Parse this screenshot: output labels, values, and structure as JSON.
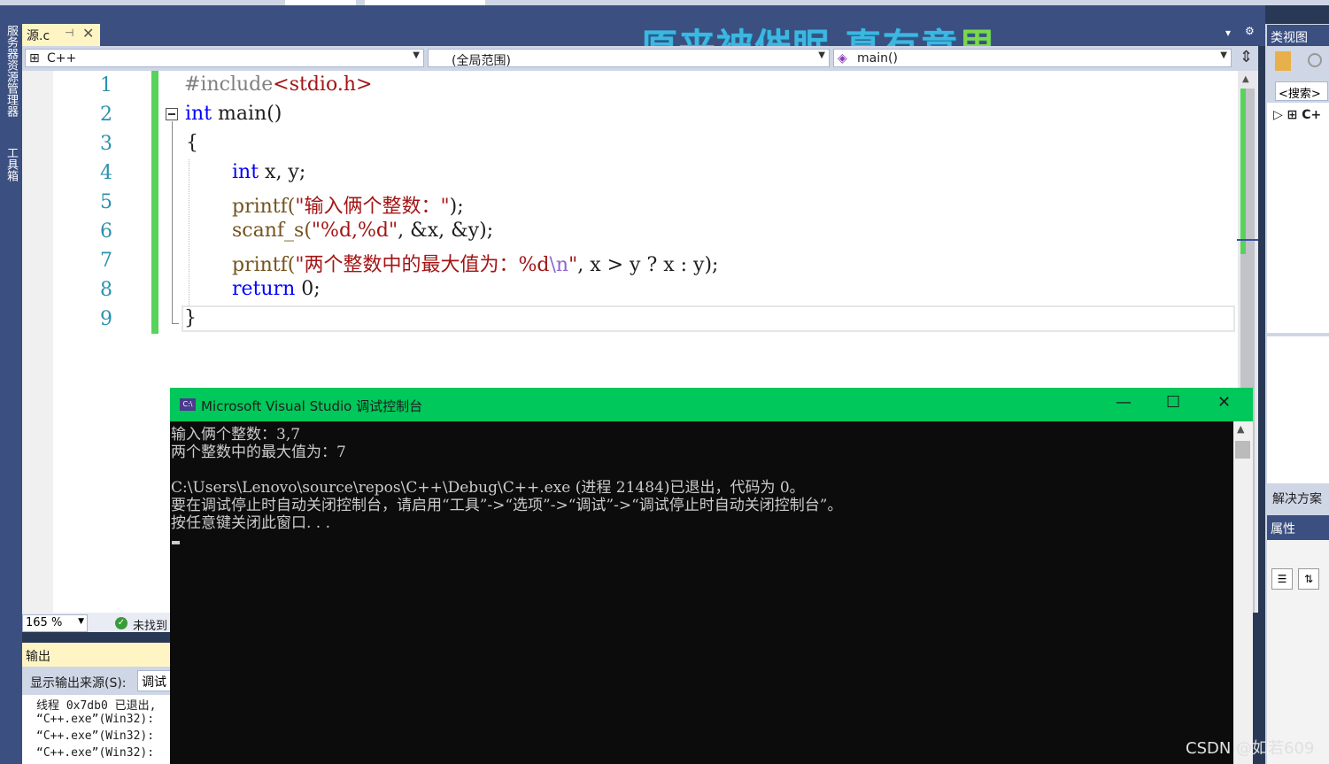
{
  "document_tab": {
    "title": "源.c",
    "pin": "⊣",
    "close": "✕"
  },
  "left_strip": {
    "tab1": "服务器资源管理器",
    "tab2": "工具箱"
  },
  "nav_bar": {
    "project": "C++",
    "scope": "(全局范围)",
    "member": "main()"
  },
  "editor": {
    "line_numbers": [
      "1",
      "2",
      "3",
      "4",
      "5",
      "6",
      "7",
      "8",
      "9"
    ],
    "lines": {
      "l1_pre": "#include",
      "l1_str": "<stdio.h>",
      "l2_kw": "int",
      "l2_rest": " main()",
      "l3": "{",
      "l4_kw": "int",
      "l4_rest": " x, y;",
      "l5_fn": "printf(",
      "l5_str": "\"输入俩个整数：\"",
      "l5_end": ");",
      "l6_fn": "scanf_s(",
      "l6_str": "\"%d,%d\"",
      "l6_end": ", &x, &y);",
      "l7_fn": "printf(",
      "l7_str": "\"两个整数中的最大值为：%d",
      "l7_esc": "\\n",
      "l7_str2": "\"",
      "l7_end": ", x > y ? x : y);",
      "l8_kw": "return",
      "l8_rest": " 0;",
      "l9": "}"
    }
  },
  "editor_status": {
    "zoom": "165 %",
    "issues": "未找到"
  },
  "output_panel": {
    "title": "输出",
    "source_label": "显示输出来源(S):",
    "source_value": "调试",
    "lines": [
      "线程 0x7db0 已退出,",
      "“C++.exe”(Win32):",
      "“C++.exe”(Win32):",
      "“C++.exe”(Win32):"
    ]
  },
  "right_panel": {
    "class_view_title": "类视图",
    "search_placeholder": "<搜索>",
    "tree_item": "C+",
    "solution_tab": "解决方案",
    "properties_title": "属性"
  },
  "console": {
    "title": "Microsoft Visual Studio 调试控制台",
    "icon_text": "C:\\",
    "minimize": "—",
    "maximize": "☐",
    "close": "✕",
    "lines": [
      "输入俩个整数：3,7",
      "两个整数中的最大值为：7",
      "",
      "C:\\Users\\Lenovo\\source\\repos\\C++\\Debug\\C++.exe (进程 21484)已退出，代码为 0。",
      "要在调试停止时自动关闭控制台，请启用“工具”->“选项”->“调试”->“调试停止时自动关闭控制台”。",
      "按任意键关闭此窗口. . ."
    ]
  },
  "watermark": {
    "text_main": "原来被催眠 真有意",
    "text_green": "思"
  },
  "footer_credit": "CSDN @如若609"
}
